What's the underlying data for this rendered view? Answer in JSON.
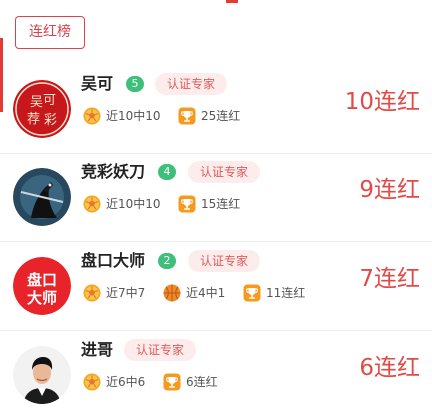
{
  "tab": {
    "label": "连红榜"
  },
  "experts": [
    {
      "name": "吴可",
      "level": "5",
      "certified": "认证专家",
      "avatar_text": [
        "吴",
        "可",
        "荐",
        "彩"
      ],
      "stats": [
        {
          "icon": "football-icon",
          "label": "近10中10"
        },
        {
          "icon": "trophy-icon",
          "label": "25连红"
        }
      ],
      "streak": "10连红"
    },
    {
      "name": "竞彩妖刀",
      "level": "4",
      "certified": "认证专家",
      "stats": [
        {
          "icon": "football-icon",
          "label": "近10中10"
        },
        {
          "icon": "trophy-icon",
          "label": "15连红"
        }
      ],
      "streak": "9连红"
    },
    {
      "name": "盘口大师",
      "level": "2",
      "certified": "认证专家",
      "avatar_text": [
        "盘口",
        "大师"
      ],
      "stats": [
        {
          "icon": "football-icon",
          "label": "近7中7"
        },
        {
          "icon": "basketball-icon",
          "label": "近4中1"
        },
        {
          "icon": "trophy-icon",
          "label": "11连红"
        }
      ],
      "streak": "7连红"
    },
    {
      "name": "进哥",
      "certified": "认证专家",
      "stats": [
        {
          "icon": "football-icon",
          "label": "近6中6"
        },
        {
          "icon": "trophy-icon",
          "label": "6连红"
        }
      ],
      "streak": "6连红"
    }
  ],
  "colors": {
    "accent": "#e24a47",
    "level_badge": "#3fc07a",
    "cert_bg": "#fdecec",
    "cert_text": "#e05a5a"
  }
}
